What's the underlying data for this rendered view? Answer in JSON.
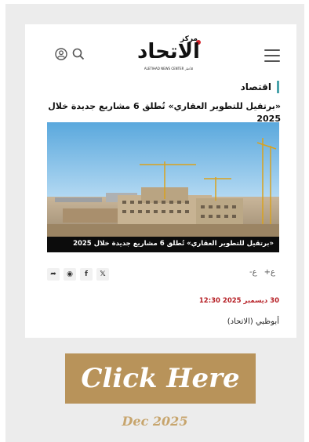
{
  "header": {
    "logo_top": "مركز",
    "logo_main": "الاتحاد",
    "logo_sub": "ALETIHAD NEWS CENTER للأخبار",
    "menu_icon": "hamburger-menu-icon",
    "search_icon": "search-icon",
    "user_icon": "user-icon"
  },
  "article": {
    "section": "اقتصاد",
    "headline": "«برتقيل للتطوير العقاري» تُطلق 6 مشاريع جديدة خلال 2025",
    "image_caption": "«برتقيل للتطوير العقاري» تُطلق 6 مشاريع جديدة خلال 2025",
    "font_decrease": "-ع",
    "font_increase": "+ع",
    "date": "30 ديسمبر 2025 12:30",
    "dateline": "أبوظبي (الاتحاد)"
  },
  "share": {
    "x_label": "𝕏",
    "facebook_label": "f",
    "whatsapp_label": "◉",
    "share_label": "➦"
  },
  "cta": {
    "label": "Click Here"
  },
  "footer": {
    "date": "Dec 2025"
  },
  "colors": {
    "accent": "#4aa3ab",
    "date_red": "#b51d23",
    "cta_bg": "#b8935a",
    "footer_gold": "#c7a56d"
  }
}
